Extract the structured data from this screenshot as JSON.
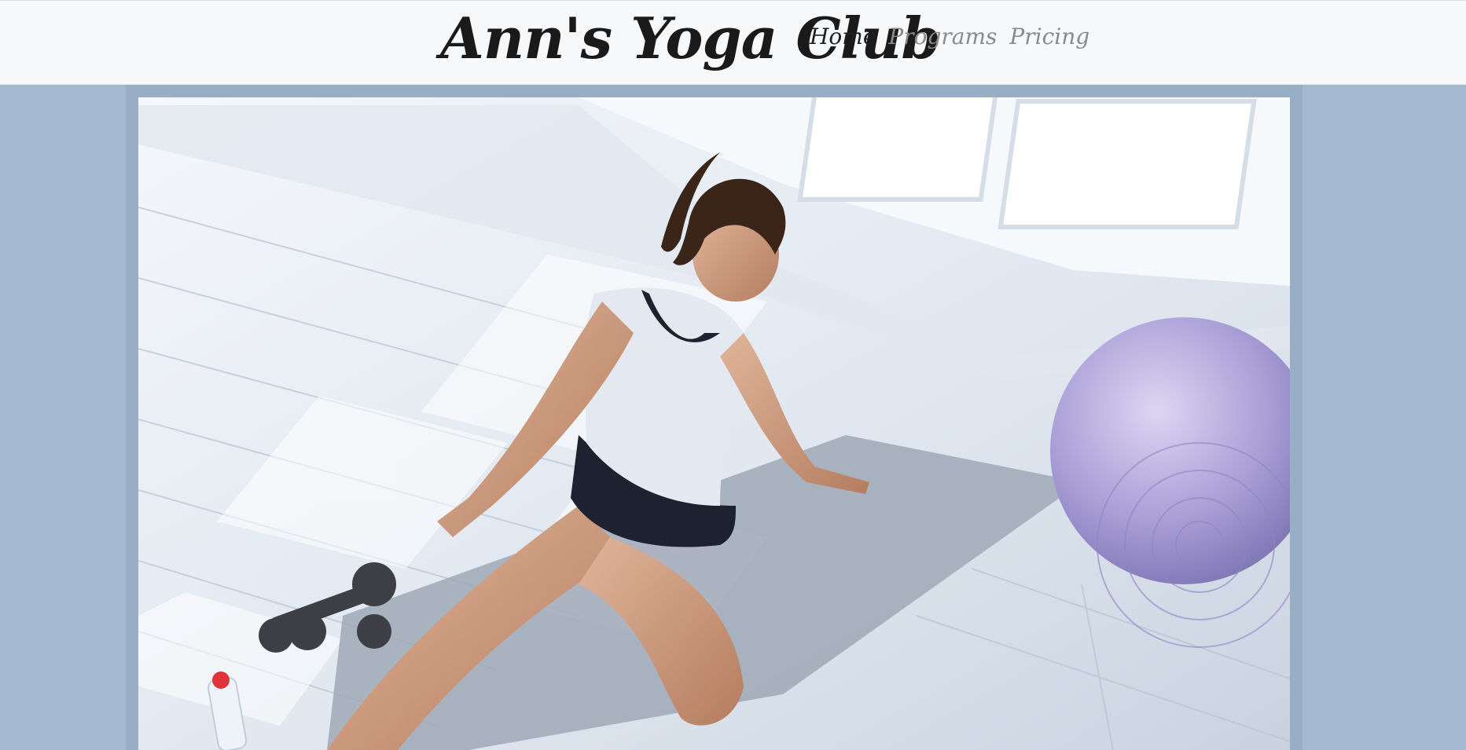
{
  "header": {
    "brand": "Ann's Yoga Club",
    "nav": [
      {
        "label": "Home",
        "active": true
      },
      {
        "label": "Programs",
        "active": false
      },
      {
        "label": "Pricing",
        "active": false
      }
    ]
  },
  "hero": {
    "alt_subject": "yoga-photo"
  },
  "colors": {
    "page_background": "#a2b9cf",
    "header_background": "#f7f8fa",
    "nav_active": "#1f1f1f",
    "nav_inactive": "#8a8a8a"
  }
}
